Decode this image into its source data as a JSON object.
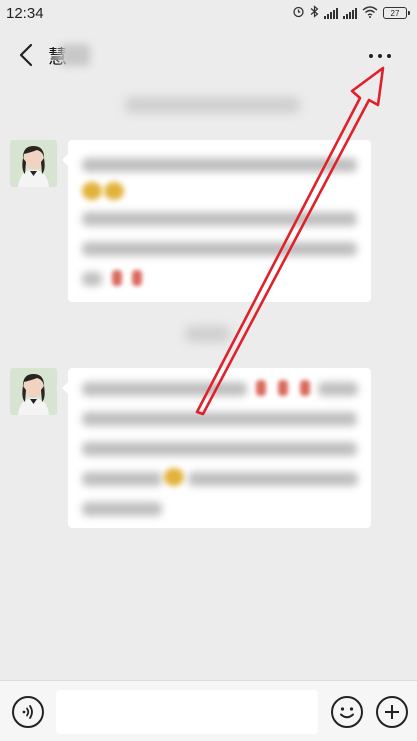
{
  "status_bar": {
    "time": "12:34",
    "battery": "27",
    "icons": [
      "alarm-icon",
      "bluetooth-icon",
      "signal-icon",
      "signal-icon",
      "wifi-icon",
      "battery-icon"
    ]
  },
  "nav": {
    "title": "慧",
    "back_icon": "chevron-left-icon",
    "more_icon": "more-dots-icon"
  },
  "messages": [
    {
      "sender": "contact",
      "content": "blurred-text",
      "has_emoji": true,
      "has_roses": true
    },
    {
      "sender": "contact",
      "content": "blurred-text",
      "has_emoji": true,
      "has_roses": true
    }
  ],
  "input_bar": {
    "voice_icon": "voice-icon",
    "input_placeholder": "",
    "emoji_icon": "emoji-icon",
    "plus_icon": "plus-icon"
  },
  "annotation": {
    "arrow_color": "#e0202a",
    "points_to": "more-button"
  },
  "colors": {
    "background": "#ececec",
    "bubble": "#ffffff",
    "input_bar": "#f6f6f6"
  }
}
